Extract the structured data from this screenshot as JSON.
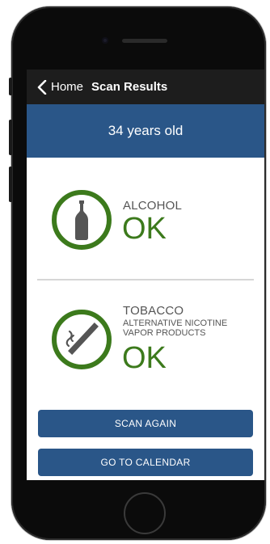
{
  "nav": {
    "back_label": "Home",
    "title": "Scan Results"
  },
  "age": {
    "text": "34 years old"
  },
  "results": [
    {
      "category": "ALCOHOL",
      "subtext": "",
      "status": "OK",
      "icon": "bottle-icon"
    },
    {
      "category": "TOBACCO",
      "subtext_line1": "ALTERNATIVE NICOTINE",
      "subtext_line2": "VAPOR PRODUCTS",
      "status": "OK",
      "icon": "cigarette-icon"
    }
  ],
  "buttons": {
    "scan_again": "SCAN AGAIN",
    "go_to_calendar": "GO TO CALENDAR"
  },
  "colors": {
    "primary": "#2a5688",
    "status_ok": "#3c7a1c",
    "navbar": "#1d1d1d"
  }
}
